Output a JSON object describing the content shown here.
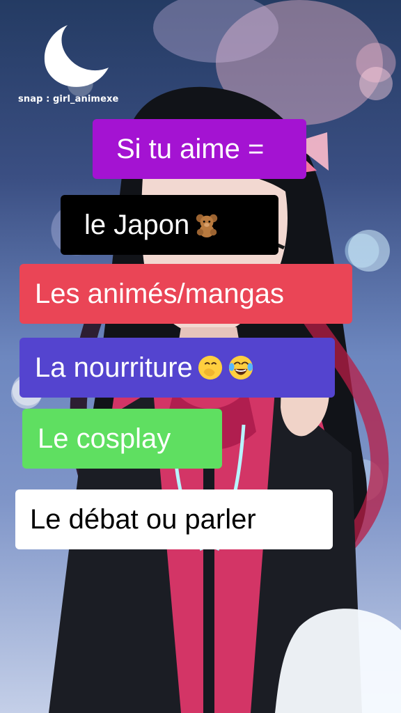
{
  "watermark": {
    "handle": "snap : girl_animexe",
    "logo_icon": "crescent-moon"
  },
  "labels": [
    {
      "text": "Si tu aime =",
      "bg": "#a413d2",
      "color": "#ffffff"
    },
    {
      "text": "le Japon",
      "emoji": [
        "teddy-bear"
      ],
      "bg": "#000000",
      "color": "#ffffff"
    },
    {
      "text": "Les animés/mangas",
      "bg": "#ea4556",
      "color": "#ffffff"
    },
    {
      "text": "La nourriture",
      "emoji": [
        "face-with-hand-over-mouth",
        "face-with-tears-of-joy"
      ],
      "bg": "#5444cf",
      "color": "#ffffff"
    },
    {
      "text": "Le cosplay",
      "bg": "#5fdf61",
      "color": "#ffffff"
    },
    {
      "text": "Le débat ou parler",
      "bg": "#ffffff",
      "color": "#000000"
    }
  ]
}
